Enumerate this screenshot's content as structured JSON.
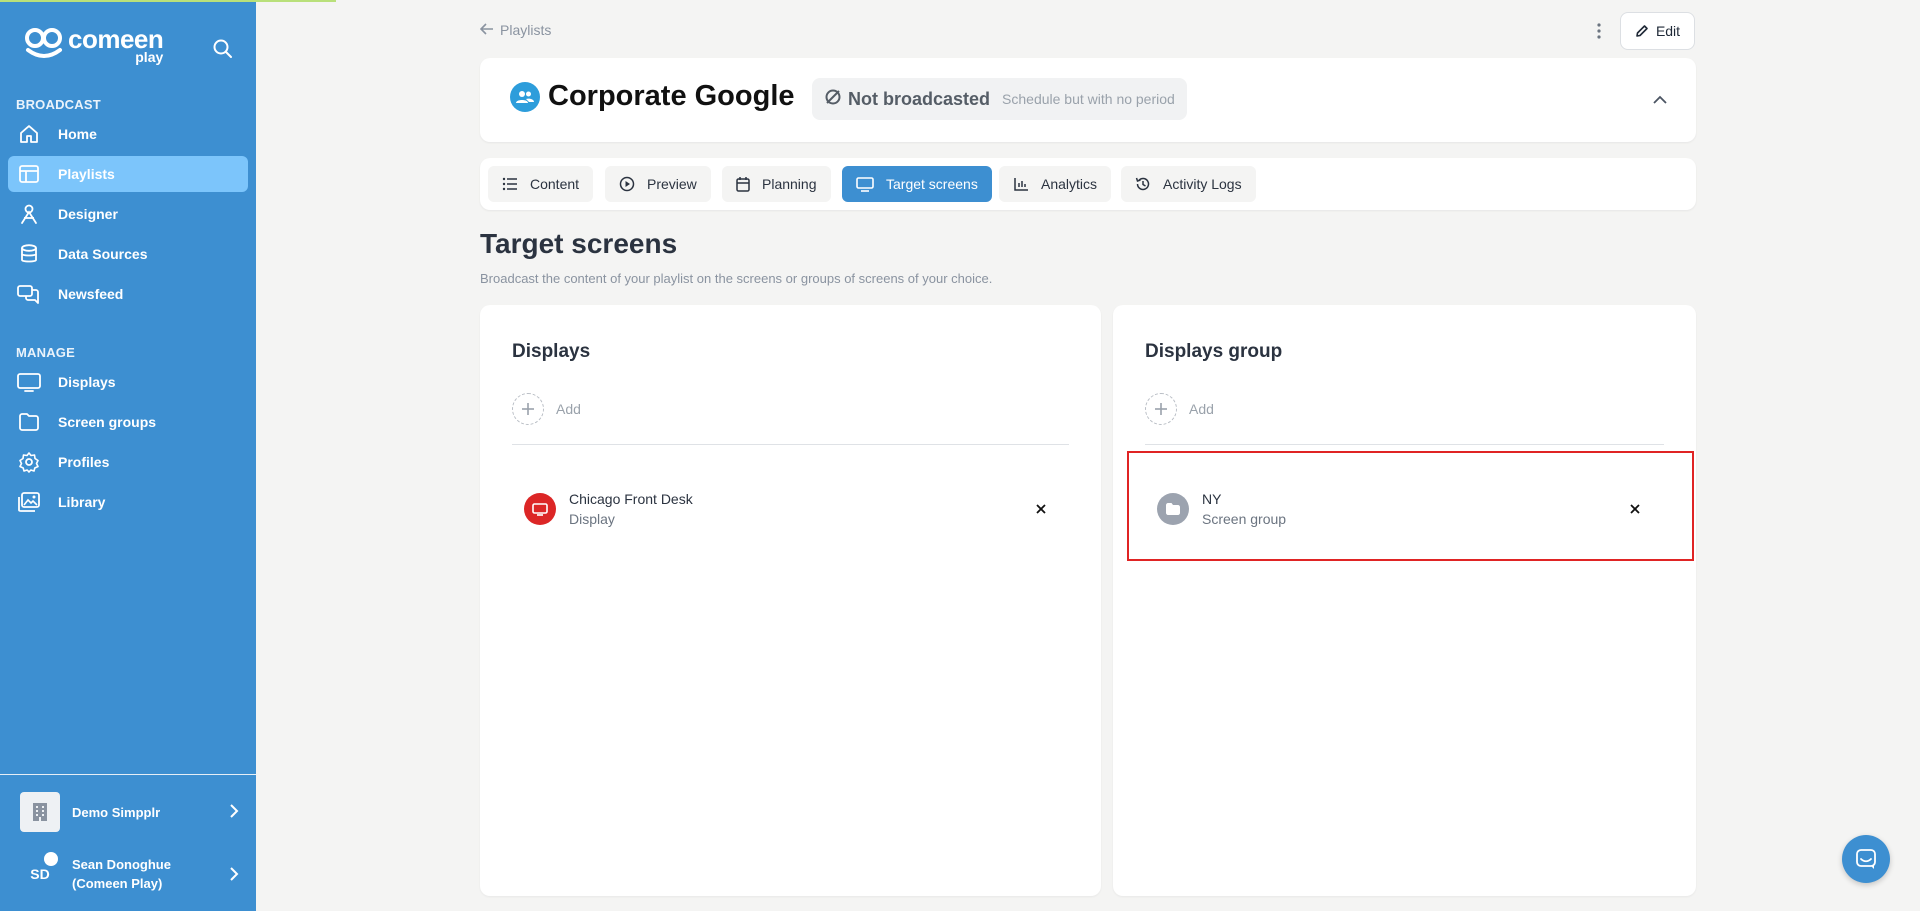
{
  "app": {
    "logo_text": "comeen",
    "logo_sub": "play"
  },
  "sidebar": {
    "sections": [
      {
        "label": "BROADCAST"
      },
      {
        "label": "MANAGE"
      }
    ],
    "broadcast_items": [
      {
        "label": "Home",
        "icon": "home-icon"
      },
      {
        "label": "Playlists",
        "icon": "playlist-icon",
        "active": true
      },
      {
        "label": "Designer",
        "icon": "designer-icon"
      },
      {
        "label": "Data Sources",
        "icon": "database-icon"
      },
      {
        "label": "Newsfeed",
        "icon": "newsfeed-icon"
      }
    ],
    "manage_items": [
      {
        "label": "Displays",
        "icon": "monitor-icon"
      },
      {
        "label": "Screen groups",
        "icon": "folder-icon"
      },
      {
        "label": "Profiles",
        "icon": "gear-icon"
      },
      {
        "label": "Library",
        "icon": "images-icon"
      }
    ],
    "organization": "Demo Simpplr",
    "user": {
      "initials": "SD",
      "name_line1": "Sean Donoghue",
      "name_line2": "(Comeen Play)"
    }
  },
  "header": {
    "back_label": "Playlists",
    "edit_label": "Edit",
    "playlist_title": "Corporate Google",
    "status": "Not broadcasted",
    "status_detail": "Schedule but with no period"
  },
  "tabs": [
    {
      "label": "Content",
      "icon": "list-icon"
    },
    {
      "label": "Preview",
      "icon": "play-circle-icon"
    },
    {
      "label": "Planning",
      "icon": "calendar-icon"
    },
    {
      "label": "Target screens",
      "icon": "monitor-icon",
      "active": true
    },
    {
      "label": "Analytics",
      "icon": "chart-icon"
    },
    {
      "label": "Activity Logs",
      "icon": "history-icon"
    }
  ],
  "page": {
    "title": "Target screens",
    "subtitle": "Broadcast the content of your playlist on the screens or groups of screens of your choice."
  },
  "displays_panel": {
    "title": "Displays",
    "add_label": "Add",
    "items": [
      {
        "name": "Chicago Front Desk",
        "type": "Display",
        "icon_color": "#dc2626"
      }
    ]
  },
  "groups_panel": {
    "title": "Displays group",
    "add_label": "Add",
    "items": [
      {
        "name": "NY",
        "type": "Screen group",
        "icon_color": "#9ca3af"
      }
    ]
  },
  "colors": {
    "sidebar": "#3d8fd1",
    "active_nav": "#7cc5fb",
    "highlight_border": "#e02424"
  }
}
